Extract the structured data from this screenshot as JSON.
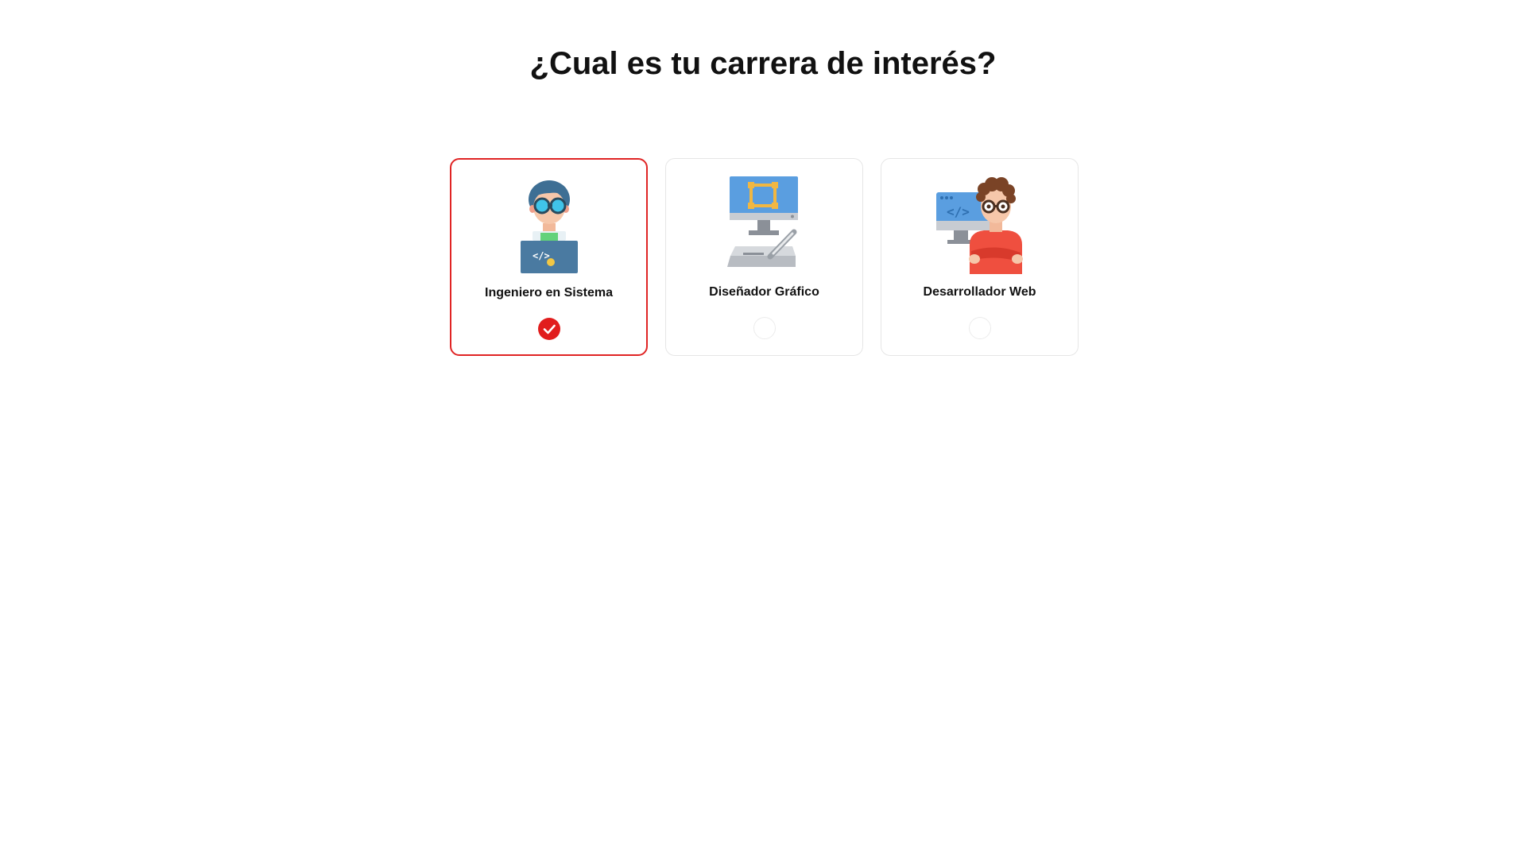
{
  "page": {
    "title": "¿Cual es tu carrera de interés?"
  },
  "colors": {
    "accent": "#e11d1d",
    "card_border": "#e6e6e6",
    "text": "#111111"
  },
  "options": [
    {
      "label": "Ingeniero en Sistema",
      "icon": "systems-engineer-icon",
      "selected": true
    },
    {
      "label": "Diseñador Gráfico",
      "icon": "graphic-designer-icon",
      "selected": false
    },
    {
      "label": "Desarrollador Web",
      "icon": "web-developer-icon",
      "selected": false
    }
  ]
}
